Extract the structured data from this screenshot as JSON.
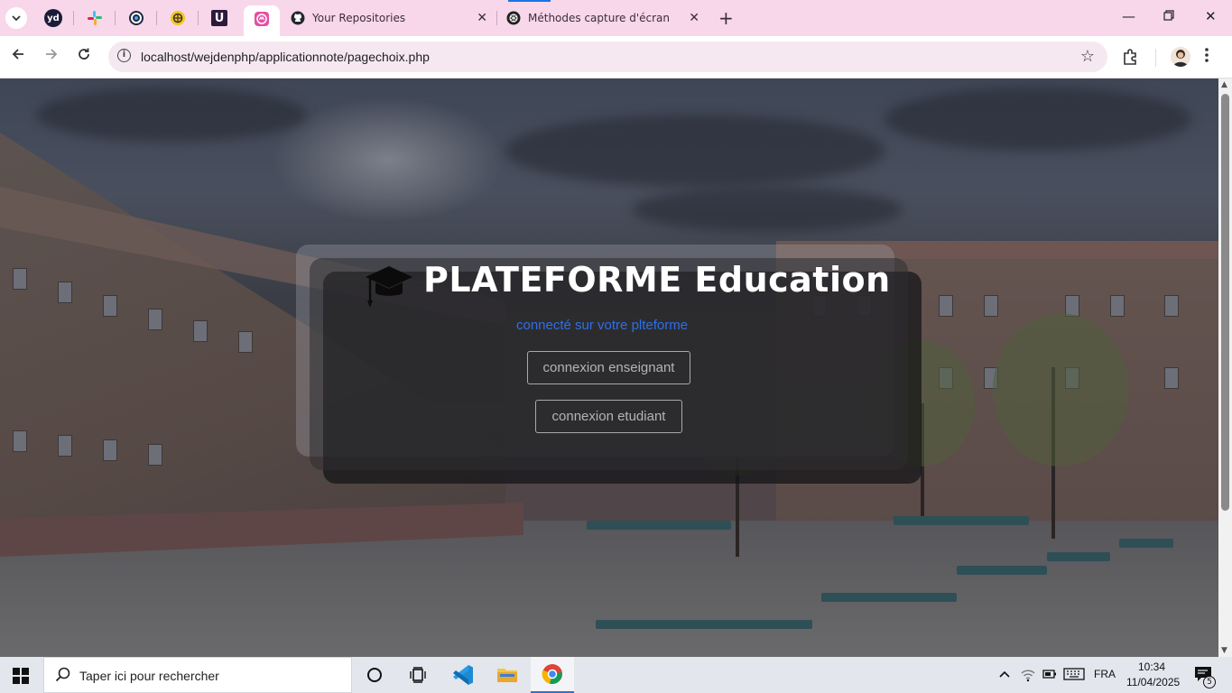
{
  "browser": {
    "tabs": [
      {
        "label": "Your Repositories",
        "icon": "github-icon"
      },
      {
        "label": "Méthodes capture d'écran",
        "icon": "chatgpt-icon"
      }
    ],
    "pinned_tabs": [
      {
        "icon": "yd-icon",
        "text": "yd"
      },
      {
        "icon": "slack-icon"
      },
      {
        "icon": "circle-app-icon"
      },
      {
        "icon": "yellow-app-icon"
      },
      {
        "icon": "udemy-icon",
        "text": "U"
      },
      {
        "icon": "localhost-app-icon",
        "active": true
      }
    ],
    "url": "localhost/wejdenphp/applicationnote/pagechoix.php"
  },
  "page": {
    "title": "PLATEFORME Education",
    "subtitle": "connecté sur votre plteforme",
    "buttons": {
      "teacher": "connexion enseignant",
      "student": "connexion etudiant"
    },
    "subtitle_color": "#2f6fe8"
  },
  "taskbar": {
    "search_placeholder": "Taper ici pour rechercher",
    "language": "FRA",
    "time": "10:34",
    "date": "11/04/2025",
    "notification_count": "5"
  }
}
